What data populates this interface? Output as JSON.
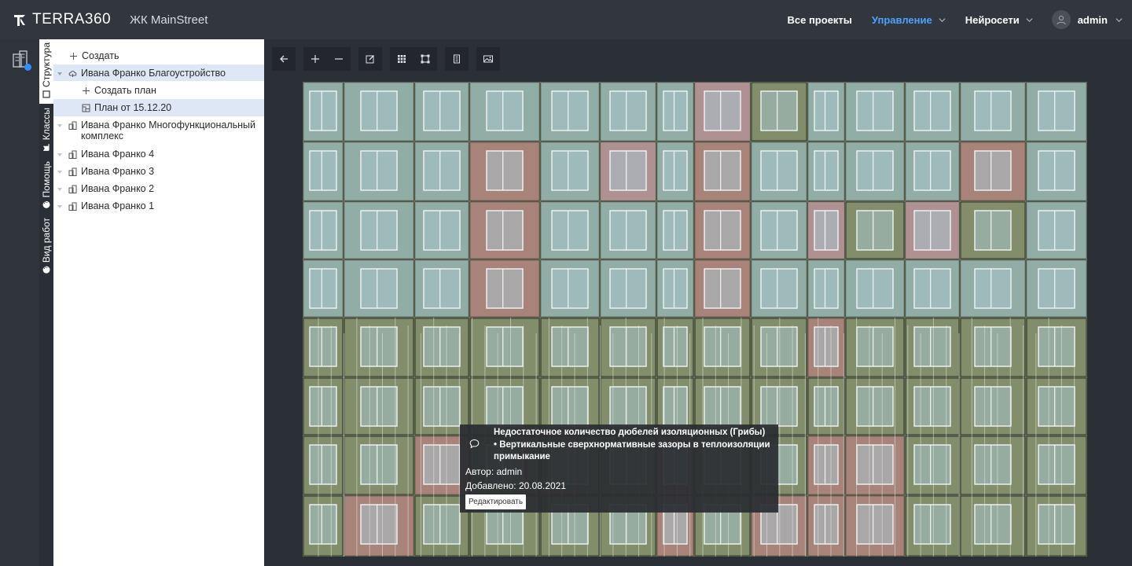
{
  "header": {
    "brand": "TERRA360",
    "project": "ЖК MainStreet",
    "nav": [
      {
        "label": "Все проекты",
        "active": false,
        "dropdown": false
      },
      {
        "label": "Управление",
        "active": true,
        "dropdown": true
      },
      {
        "label": "Нейросети",
        "active": false,
        "dropdown": true
      }
    ],
    "user": "admin",
    "accent_color": "#4aa3ff"
  },
  "vtabs": [
    {
      "label": "Структура",
      "icon": "square-icon",
      "active": true
    },
    {
      "label": "Классы",
      "icon": "flag-icon",
      "active": false
    },
    {
      "label": "Помощь",
      "icon": "help-icon",
      "active": false
    },
    {
      "label": "Вид работ",
      "icon": "help-icon",
      "active": false
    }
  ],
  "tree": {
    "create": "Создать",
    "items": [
      {
        "label": "Ивана Франко Благоустройство",
        "level": 0,
        "selected": true,
        "expanded": true,
        "icon": "cloud-icon"
      },
      {
        "label": "Создать план",
        "level": 1,
        "selected": false,
        "icon": "plus-icon"
      },
      {
        "label": "План от 15.12.20",
        "level": 1,
        "selected": true,
        "icon": "plan-icon"
      },
      {
        "label": "Ивана Франко Многофункциональный комплекс",
        "level": 0,
        "selected": false,
        "icon": "building-icon"
      },
      {
        "label": "Ивана Франко 4",
        "level": 0,
        "selected": false,
        "icon": "building-icon"
      },
      {
        "label": "Ивана Франко 3",
        "level": 0,
        "selected": false,
        "icon": "building-icon"
      },
      {
        "label": "Ивана Франко 2",
        "level": 0,
        "selected": false,
        "icon": "building-icon"
      },
      {
        "label": "Ивана Франко 1",
        "level": 0,
        "selected": false,
        "icon": "building-icon"
      }
    ]
  },
  "toolbar": {
    "buttons": [
      "back-icon",
      "zoom-in-icon",
      "zoom-out-icon",
      "edit-icon",
      "grid-icon",
      "select-area-icon",
      "building-view-icon",
      "image-compare-icon"
    ]
  },
  "tooltip": {
    "title_line1": "Недостаточное количество дюбелей изоляционных (Грибы)",
    "title_line2": "• Вертикальные сверхнормативные зазоры в теплоизоляции примыкание",
    "author": "Автор: admin",
    "added": "Добавлено: 20.08.2021",
    "edit_label": "Редактировать"
  }
}
